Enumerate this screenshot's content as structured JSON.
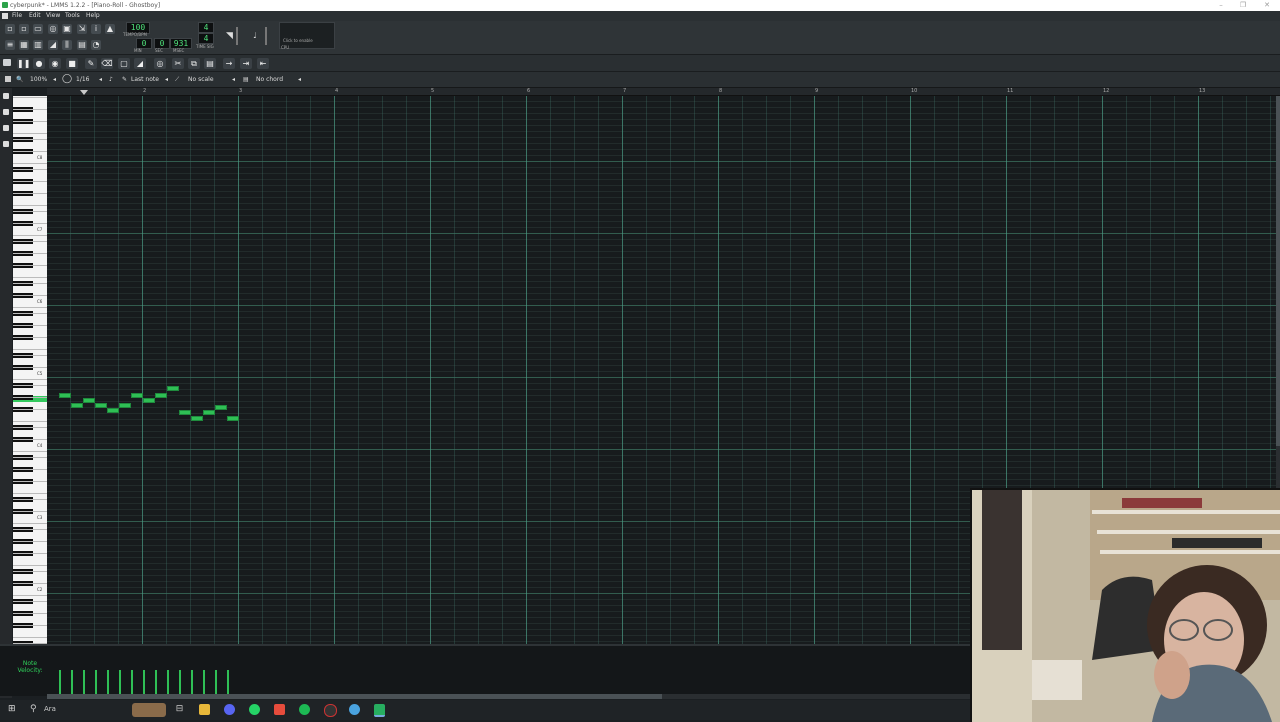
{
  "window": {
    "title": "cyberpunk* - LMMS 1.2.2 - [Piano-Roll - Ghostboy]"
  },
  "menu": [
    "File",
    "Edit",
    "View",
    "Tools",
    "Help"
  ],
  "transport": {
    "tempo_value": "100",
    "tempo_label": "TEMPO/BPM",
    "min_value": "0",
    "sec_value": "0",
    "msec_value": "931",
    "min_label": "MIN",
    "sec_label": "SEC",
    "msec_label": "MSEC",
    "timesig_num": "4",
    "timesig_den": "4",
    "timesig_label": "TIME SIG",
    "cpu_hint": "Click to enable",
    "cpu_label": "CPU"
  },
  "piano_roll": {
    "zoom": "100%",
    "quantize": "1/16",
    "note_length": "Last note",
    "scale": "No scale",
    "chord": "No chord",
    "bar_numbers": [
      "2",
      "3",
      "4",
      "5",
      "6",
      "7",
      "8",
      "9",
      "10",
      "11",
      "12",
      "13"
    ],
    "octave_labels": [
      "C8",
      "C7",
      "C6",
      "C5",
      "C4",
      "C3",
      "C2"
    ],
    "velocity_label": "Note Velocity:"
  },
  "taskbar": {
    "search_text": "Ara"
  },
  "colors": {
    "note": "#2fbf55",
    "grid_bar": "#4ea58c",
    "lcd_text": "#4fe07a"
  }
}
